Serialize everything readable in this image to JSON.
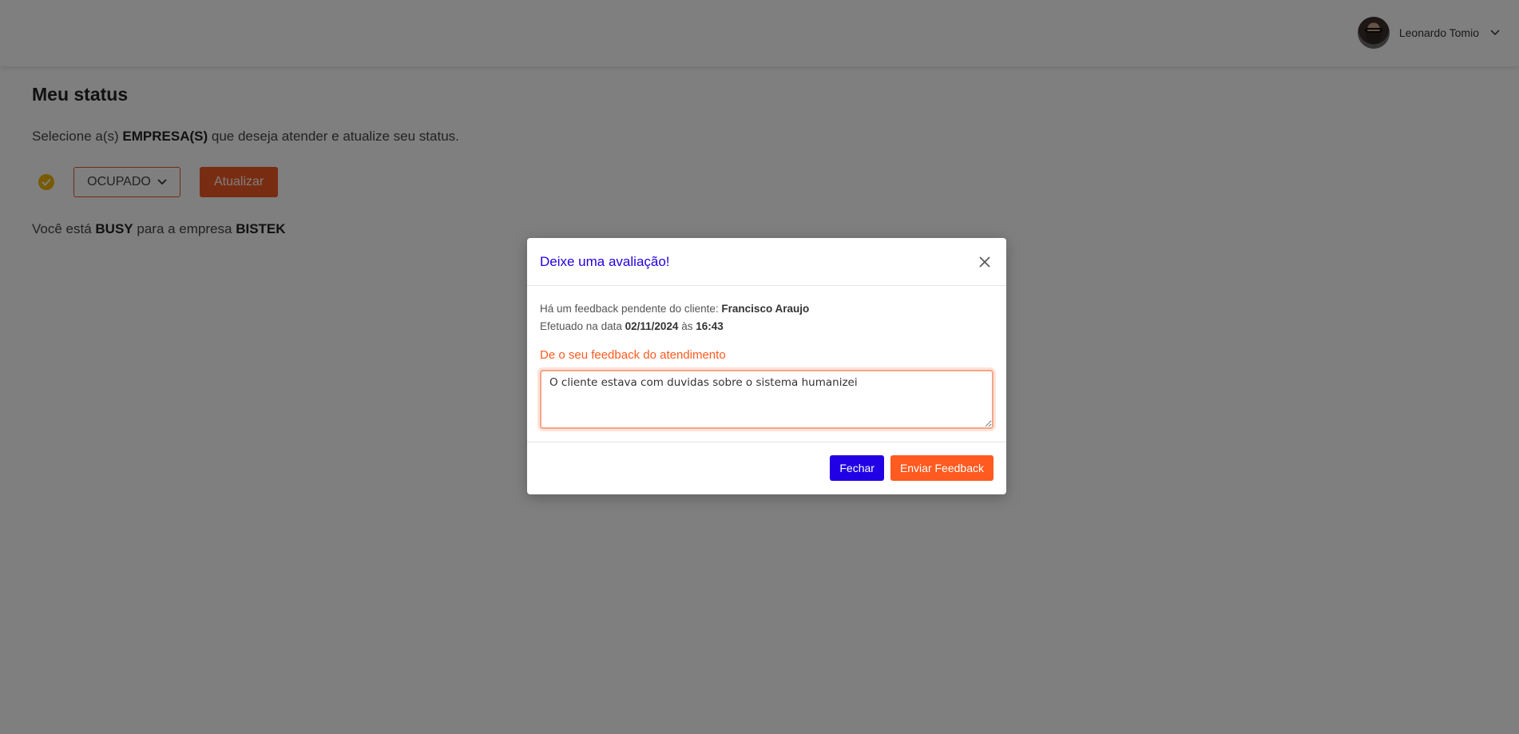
{
  "header": {
    "user_name": "Leonardo Tomio",
    "avatar_icon": "user-avatar"
  },
  "page": {
    "title": "Meu status",
    "subtitle_prefix": "Selecione a(s)",
    "subtitle_bold": "EMPRESA(S)",
    "subtitle_suffix": "que deseja atender e atualize seu status.",
    "status_select_value": "OCUPADO",
    "update_button": "Atualizar",
    "status_line_prefix": "Você está",
    "status_line_status": "BUSY",
    "status_line_middle": "para a empresa",
    "status_line_company": "BISTEK"
  },
  "modal": {
    "title": "Deixe uma avaliação!",
    "pending_prefix": "Há um feedback pendente do cliente:",
    "client_name": "Francisco Araujo",
    "date_prefix": "Efetuado na data",
    "date": "02/11/2024",
    "time_prefix": "às",
    "time": "16:43",
    "feedback_label": "De o seu feedback do atendimento",
    "feedback_value": "O cliente estava com duvidas sobre o sistema humanizei",
    "close_button": "Fechar",
    "send_button": "Enviar Feedback"
  },
  "colors": {
    "accent_orange": "#ff5a1f",
    "accent_blue": "#2100e6",
    "status_yellow": "#f0b400"
  }
}
